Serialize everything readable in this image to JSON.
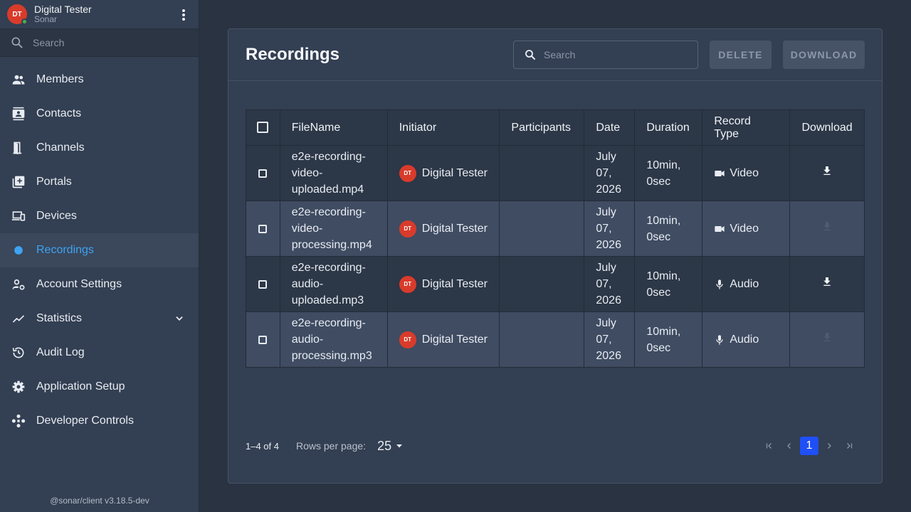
{
  "profile": {
    "initials": "DT",
    "name": "Digital Tester",
    "org": "Sonar"
  },
  "sidebar": {
    "search_placeholder": "Search",
    "items": [
      {
        "label": "Members",
        "icon": "people-icon"
      },
      {
        "label": "Contacts",
        "icon": "contacts-icon"
      },
      {
        "label": "Channels",
        "icon": "door-icon"
      },
      {
        "label": "Portals",
        "icon": "add-box-icon"
      },
      {
        "label": "Devices",
        "icon": "devices-icon"
      },
      {
        "label": "Recordings",
        "icon": "record-dot-icon",
        "active": true
      },
      {
        "label": "Account Settings",
        "icon": "manage-accounts-icon"
      },
      {
        "label": "Statistics",
        "icon": "trending-icon",
        "expandable": true
      },
      {
        "label": "Audit Log",
        "icon": "history-icon"
      },
      {
        "label": "Application Setup",
        "icon": "gear-icon"
      },
      {
        "label": "Developer Controls",
        "icon": "hub-icon"
      }
    ],
    "version": "@sonar/client v3.18.5-dev"
  },
  "main": {
    "title": "Recordings",
    "search_placeholder": "Search",
    "delete_label": "DELETE",
    "download_label": "DOWNLOAD"
  },
  "table": {
    "columns": [
      "FileName",
      "Initiator",
      "Participants",
      "Date",
      "Duration",
      "Record Type",
      "Download"
    ],
    "rows": [
      {
        "file": "e2e-recording-video-uploaded.mp4",
        "file_lines": [
          "e2e-recording-",
          "video-",
          "uploaded.mp4"
        ],
        "initiator_initials": "DT",
        "initiator": "Digital Tester",
        "participants": "",
        "date_lines": [
          "July",
          "07,",
          "2026"
        ],
        "duration_lines": [
          "10min,",
          "0sec"
        ],
        "type": "Video",
        "type_icon": "videocam-icon",
        "download_enabled": true
      },
      {
        "file": "e2e-recording-video-processing.mp4",
        "file_lines": [
          "e2e-recording-",
          "video-",
          "processing.mp4"
        ],
        "initiator_initials": "DT",
        "initiator": "Digital Tester",
        "participants": "",
        "date_lines": [
          "July",
          "07,",
          "2026"
        ],
        "duration_lines": [
          "10min,",
          "0sec"
        ],
        "type": "Video",
        "type_icon": "videocam-icon",
        "download_enabled": false
      },
      {
        "file": "e2e-recording-audio-uploaded.mp3",
        "file_lines": [
          "e2e-recording-",
          "audio-",
          "uploaded.mp3"
        ],
        "initiator_initials": "DT",
        "initiator": "Digital Tester",
        "participants": "",
        "date_lines": [
          "July",
          "07,",
          "2026"
        ],
        "duration_lines": [
          "10min,",
          "0sec"
        ],
        "type": "Audio",
        "type_icon": "mic-icon",
        "download_enabled": true
      },
      {
        "file": "e2e-recording-audio-processing.mp3",
        "file_lines": [
          "e2e-recording-",
          "audio-",
          "processing.mp3"
        ],
        "initiator_initials": "DT",
        "initiator": "Digital Tester",
        "participants": "",
        "date_lines": [
          "July",
          "07,",
          "2026"
        ],
        "duration_lines": [
          "10min,",
          "0sec"
        ],
        "type": "Audio",
        "type_icon": "mic-icon",
        "download_enabled": false
      }
    ]
  },
  "pagination": {
    "range": "1–4 of 4",
    "rows_per_page_label": "Rows per page:",
    "rows_per_page": "25",
    "current_page": "1"
  },
  "colors": {
    "accent": "#3ea3f2",
    "avatar": "#d93b2b",
    "page_active": "#1f4ff5",
    "online": "#4caf50"
  }
}
